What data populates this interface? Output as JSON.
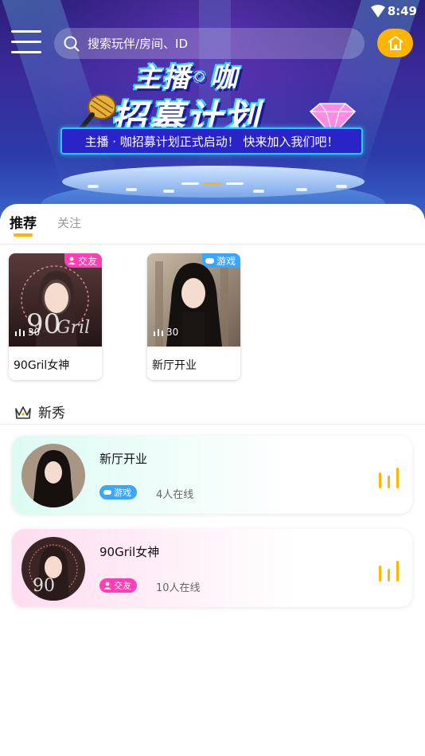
{
  "status_bar": {
    "time": "8:49"
  },
  "search": {
    "placeholder": "搜索玩伴/房间、ID"
  },
  "banner": {
    "title_line1": "主播◦咖",
    "title_line2": "招募计划",
    "subtitle": "主播 · 咖招募计划正式启动！ 快来加入我们吧！",
    "slides": 3,
    "active_slide": 2
  },
  "tabs": [
    {
      "label": "推荐",
      "active": true
    },
    {
      "label": "关注",
      "active": false
    }
  ],
  "rooms": [
    {
      "name": "90Gril女神",
      "tag": "交友",
      "tag_color": "#ff3fb5",
      "count": "30"
    },
    {
      "name": "新厅开业",
      "tag": "游戏",
      "tag_color": "#3aa7ff",
      "count": "30"
    }
  ],
  "section": {
    "title": "新秀"
  },
  "live_list": [
    {
      "name": "新厅开业",
      "tag": "游戏",
      "tag_color": "#3aa7ff",
      "online": "4人在线"
    },
    {
      "name": "90Gril女神",
      "tag": "交友",
      "tag_color": "#ff3fb5",
      "online": "10人在线"
    }
  ],
  "colors": {
    "accent": "#ffb400",
    "banner_bg": "#2c3aa8"
  }
}
